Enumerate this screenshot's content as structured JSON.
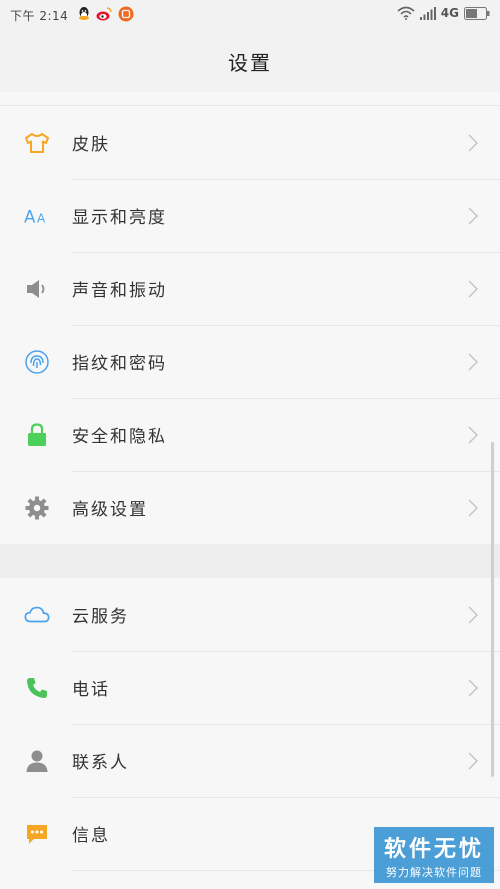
{
  "status_bar": {
    "time": "下午 2:14",
    "network": "4G",
    "notification_icons": [
      "qq-icon",
      "weibo-icon",
      "app-icon"
    ]
  },
  "header": {
    "title": "设置"
  },
  "settings": {
    "group1": [
      {
        "label": "皮肤",
        "icon": "shirt-icon",
        "color": "#f5a623"
      },
      {
        "label": "显示和亮度",
        "icon": "font-size-icon",
        "color": "#4aa3ef"
      },
      {
        "label": "声音和振动",
        "icon": "speaker-icon",
        "color": "#8e8e8e"
      },
      {
        "label": "指纹和密码",
        "icon": "fingerprint-icon",
        "color": "#4aa3ef"
      },
      {
        "label": "安全和隐私",
        "icon": "lock-icon",
        "color": "#4cd05a"
      },
      {
        "label": "高级设置",
        "icon": "gear-icon",
        "color": "#8e8e8e"
      }
    ],
    "group2": [
      {
        "label": "云服务",
        "icon": "cloud-icon",
        "color": "#4aa3ef"
      },
      {
        "label": "电话",
        "icon": "phone-icon",
        "color": "#4cc35a"
      },
      {
        "label": "联系人",
        "icon": "contact-icon",
        "color": "#8e8e8e"
      },
      {
        "label": "信息",
        "icon": "message-icon",
        "color": "#f5a623"
      }
    ]
  },
  "watermark": {
    "title": "软件无忧",
    "subtitle": "努力解决软件问题"
  }
}
